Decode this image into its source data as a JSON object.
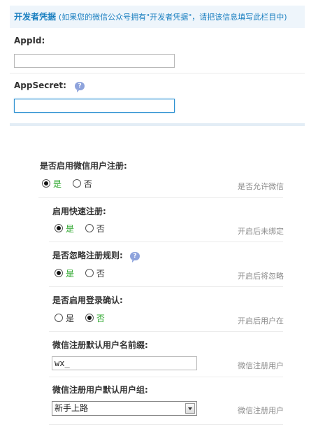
{
  "credentials": {
    "title": "开发者凭据",
    "note": "(如果您的微信公众号拥有\"开发者凭据\"，请把该信息填写此栏目中)",
    "appid_label": "AppId:",
    "appid_value": "",
    "appsecret_label": "AppSecret:",
    "appsecret_value": "",
    "help_glyph": "?"
  },
  "settings": {
    "enable_register": {
      "label": "是否启用微信用户注册:",
      "options": [
        "是",
        "否"
      ],
      "selected": "是",
      "hint": "是否允许微信"
    },
    "quick_register": {
      "label": "启用快速注册:",
      "options": [
        "是",
        "否"
      ],
      "selected": "是",
      "hint": "开启后未绑定"
    },
    "ignore_rules": {
      "label": "是否忽略注册规则:",
      "options": [
        "是",
        "否"
      ],
      "selected": "是",
      "hint": "开启后将忽略"
    },
    "login_confirm": {
      "label": "是否启用登录确认:",
      "options": [
        "是",
        "否"
      ],
      "selected": "否",
      "hint": "开启后用户在"
    },
    "username_prefix": {
      "label": "微信注册默认用户名前缀:",
      "value": "wx_",
      "hint": "微信注册用户"
    },
    "default_group": {
      "label": "微信注册用户默认用户组:",
      "selected": "新手上路",
      "hint": "微信注册用户"
    }
  }
}
